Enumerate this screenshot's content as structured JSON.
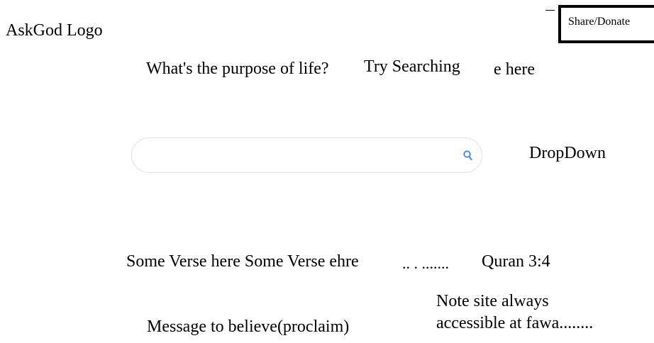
{
  "header": {
    "logo_text": "AskGod Logo",
    "share_label": "Share/Donate"
  },
  "hero": {
    "question": "What's the purpose of life?",
    "try_searching": "Try Searching",
    "question_tail": "e here"
  },
  "search": {
    "value": "",
    "placeholder": "",
    "icon": "search-icon",
    "icon_color": "#4285f4"
  },
  "dropdown": {
    "label": "DropDown"
  },
  "verse": {
    "text": "Some Verse here Some Verse ehre",
    "ellipsis": ".. . .......",
    "reference": "Quran 3:4"
  },
  "footer": {
    "message": "Message to believe(proclaim)",
    "note_line1": "Note site always",
    "note_line2": "accessible at fawa........"
  }
}
